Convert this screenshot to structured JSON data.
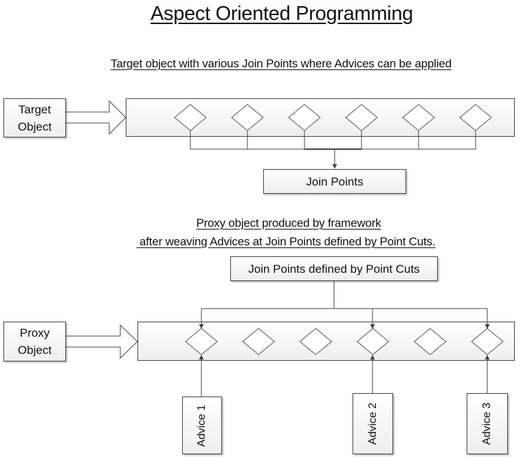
{
  "title": "Aspect Oriented Programming",
  "target_section": {
    "caption": "Target object with various Join Points where Advices can be applied",
    "source_box": {
      "line1": "Target",
      "line2": "Object"
    },
    "join_point_count": 6,
    "collector_box": "Join Points"
  },
  "proxy_section": {
    "caption_line1": "Proxy object produced by framework",
    "caption_line2": " after weaving Advices at Join Points defined by Point Cuts.",
    "pointcut_box": "Join Points defined by Point Cuts",
    "source_box": {
      "line1": "Proxy",
      "line2": "Object"
    },
    "join_point_count": 6,
    "advised_join_points": [
      1,
      4,
      6
    ],
    "advices": [
      "Advice 1",
      "Advice 2",
      "Advice 3"
    ]
  },
  "colors": {
    "stroke": "#444444",
    "box_fill_top": "#ffffff",
    "box_fill_bottom": "#eeeeee",
    "text": "#111111"
  }
}
